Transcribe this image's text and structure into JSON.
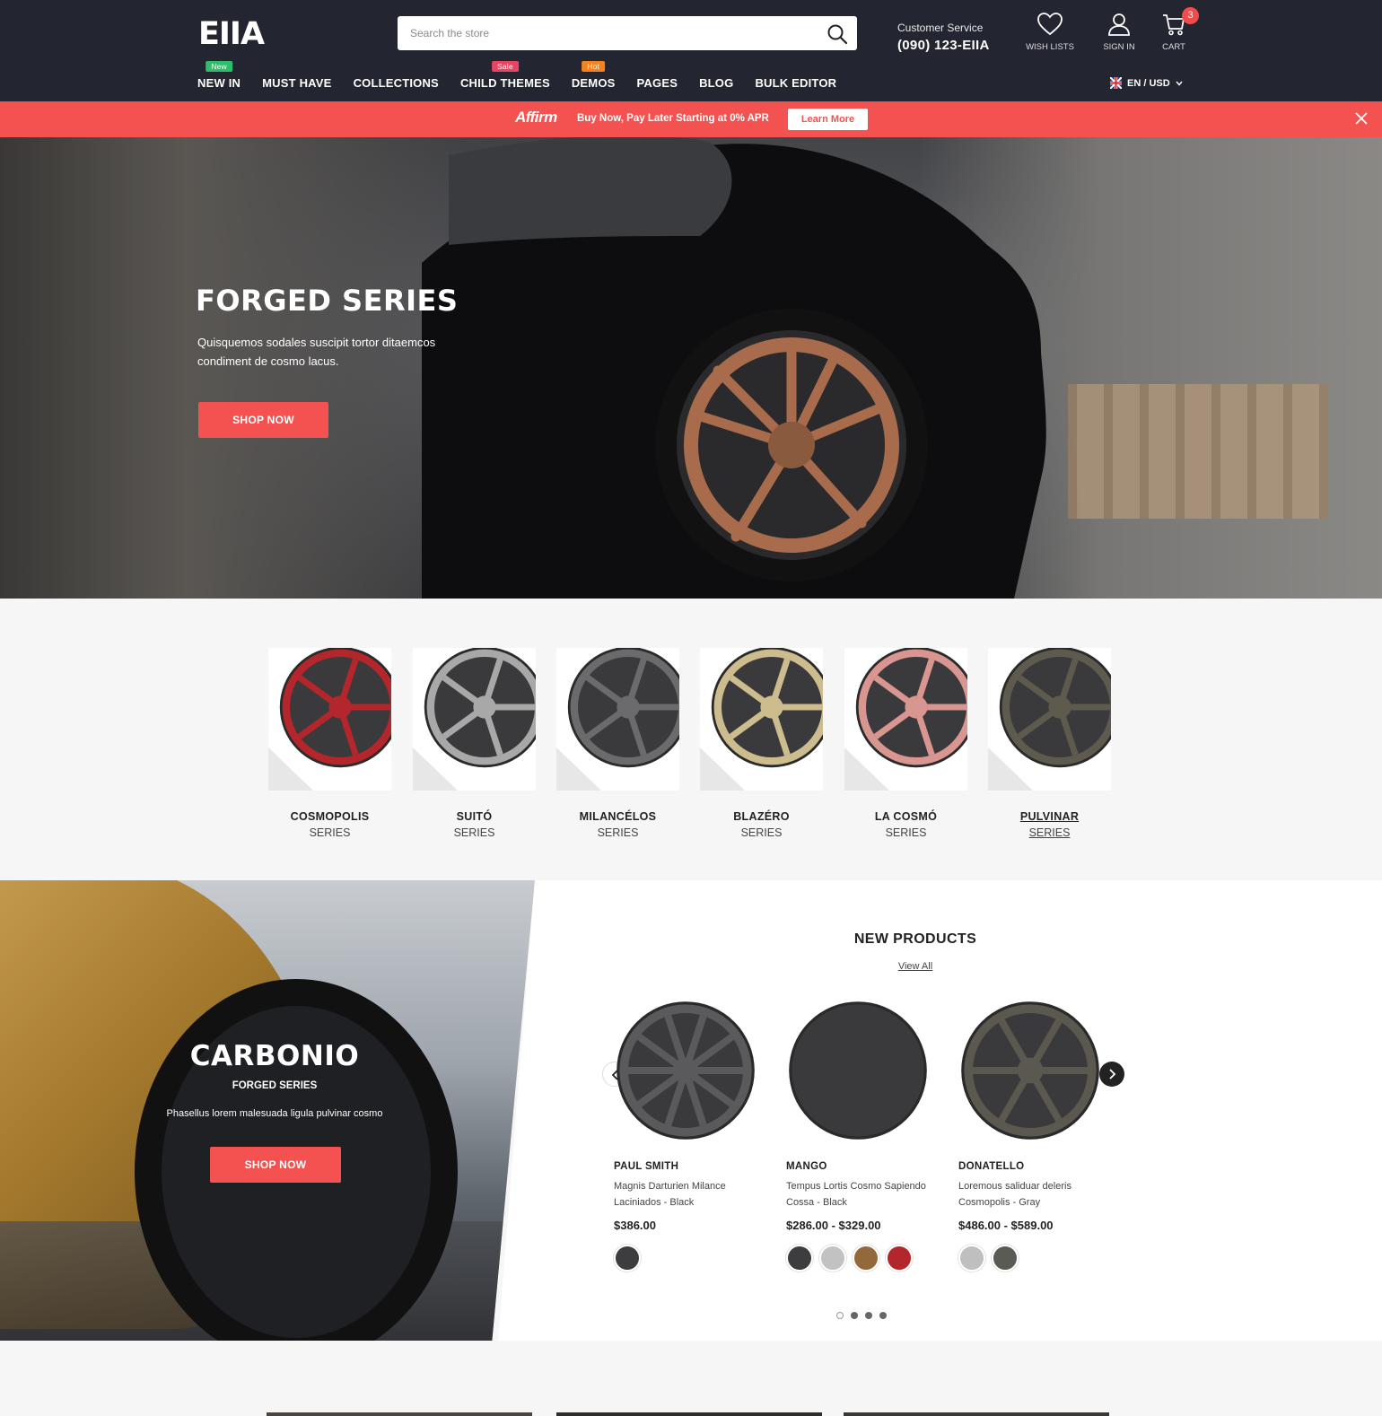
{
  "header": {
    "logo": "EIIA",
    "search_placeholder": "Search the store",
    "customer_service_label": "Customer Service",
    "customer_service_phone": "(090) 123-EIIA",
    "wishlist_label": "WISH LISTS",
    "signin_label": "SIGN IN",
    "cart_label": "CART",
    "cart_count": "3",
    "lang_currency": "EN / USD"
  },
  "nav": {
    "items": [
      {
        "label": "NEW IN",
        "badge": "New",
        "badge_color": "#2ebd6b"
      },
      {
        "label": "MUST HAVE",
        "badge": "",
        "badge_color": ""
      },
      {
        "label": "COLLECTIONS",
        "badge": "",
        "badge_color": ""
      },
      {
        "label": "CHILD THEMES",
        "badge": "Sale",
        "badge_color": "#e94463"
      },
      {
        "label": "DEMOS",
        "badge": "Hot",
        "badge_color": "#f5821f"
      },
      {
        "label": "PAGES",
        "badge": "",
        "badge_color": ""
      },
      {
        "label": "BLOG",
        "badge": "",
        "badge_color": ""
      },
      {
        "label": "BULK EDITOR",
        "badge": "",
        "badge_color": ""
      }
    ]
  },
  "promo_bar": {
    "brand": "Affirm",
    "text": "Buy Now, Pay Later Starting at 0% APR",
    "button": "Learn More",
    "color": "#f35250"
  },
  "hero": {
    "title": "FORGED SERIES",
    "subtitle": "Quisquemos sodales suscipit tortor ditaemcos condiment de cosmo lacus.",
    "button": "SHOP NOW"
  },
  "series": [
    {
      "name": "COSMOPOLIS",
      "sub": "SERIES",
      "color": "#b3262b"
    },
    {
      "name": "SUITÓ",
      "sub": "SERIES",
      "color": "#a8a8a8"
    },
    {
      "name": "MILANCÉLOS",
      "sub": "SERIES",
      "color": "#6b6b6d"
    },
    {
      "name": "BLAZÉRO",
      "sub": "SERIES",
      "color": "#cdbd8e"
    },
    {
      "name": "LA COSMÓ",
      "sub": "SERIES",
      "color": "#d9958f"
    },
    {
      "name": "PULVINAR",
      "sub": "SERIES",
      "color": "#5e5a4e"
    }
  ],
  "carbonio": {
    "title": "CARBONIO",
    "subtitle": "FORGED SERIES",
    "desc": "Phasellus lorem malesuada ligula pulvinar cosmo",
    "button": "SHOP NOW"
  },
  "new_products": {
    "title": "NEW PRODUCTS",
    "view_all": "View All",
    "items": [
      {
        "brand": "PAUL SMITH",
        "name": "Magnis Darturien Milance Laciniados - Black",
        "price": "$386.00",
        "swatches": [
          "#3d3d3f"
        ]
      },
      {
        "brand": "MANGO",
        "name": "Tempus Lortis Cosmo Sapiendo Cossa - Black",
        "price": "$286.00 - $329.00",
        "swatches": [
          "#3d3d3f",
          "#c2c2c2",
          "#93693c",
          "#b3262b"
        ]
      },
      {
        "brand": "DONATELLO",
        "name": "Loremous saliduar deleris Cosmopolis - Gray",
        "price": "$486.00 - $589.00",
        "swatches": [
          "#bfbfbf",
          "#5b5b55"
        ]
      }
    ]
  }
}
